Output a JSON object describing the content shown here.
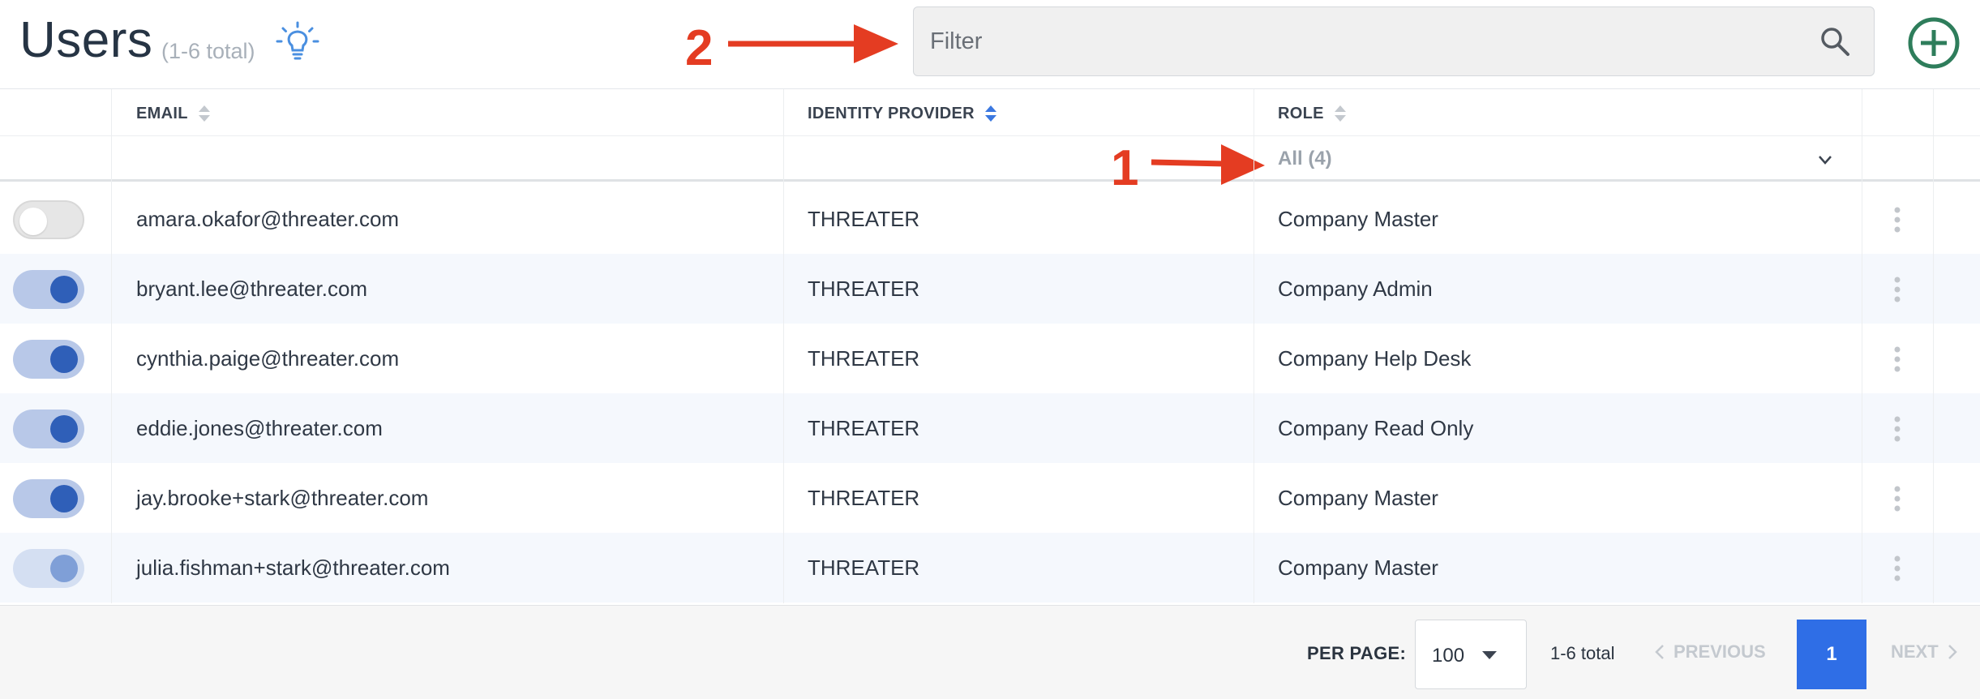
{
  "header": {
    "title": "Users",
    "subtitle": "(1-6 total)",
    "tip_icon": "lightbulb-icon",
    "filter_placeholder": "Filter",
    "search_icon": "search-icon",
    "add_icon": "plus-circle-icon",
    "add_color": "#2e7d5b"
  },
  "annotations": {
    "one": "1",
    "two": "2",
    "color": "#e43c22"
  },
  "table": {
    "columns": {
      "email": "EMAIL",
      "identity_provider": "IDENTITY PROVIDER",
      "role": "ROLE"
    },
    "role_filter": "All (4)",
    "rows": [
      {
        "enabled": "off",
        "email": "amara.okafor@threater.com",
        "provider": "THREATER",
        "role": "Company Master"
      },
      {
        "enabled": "on",
        "email": "bryant.lee@threater.com",
        "provider": "THREATER",
        "role": "Company Admin"
      },
      {
        "enabled": "on",
        "email": "cynthia.paige@threater.com",
        "provider": "THREATER",
        "role": "Company Help Desk"
      },
      {
        "enabled": "on",
        "email": "eddie.jones@threater.com",
        "provider": "THREATER",
        "role": "Company Read Only"
      },
      {
        "enabled": "on",
        "email": "jay.brooke+stark@threater.com",
        "provider": "THREATER",
        "role": "Company Master"
      },
      {
        "enabled": "pending",
        "email": "julia.fishman+stark@threater.com",
        "provider": "THREATER",
        "role": "Company Master"
      }
    ]
  },
  "footer": {
    "per_page_label": "PER PAGE:",
    "per_page_value": "100",
    "total": "1-6 total",
    "previous": "PREVIOUS",
    "page": "1",
    "next": "NEXT",
    "accent": "#2f6ee6"
  }
}
